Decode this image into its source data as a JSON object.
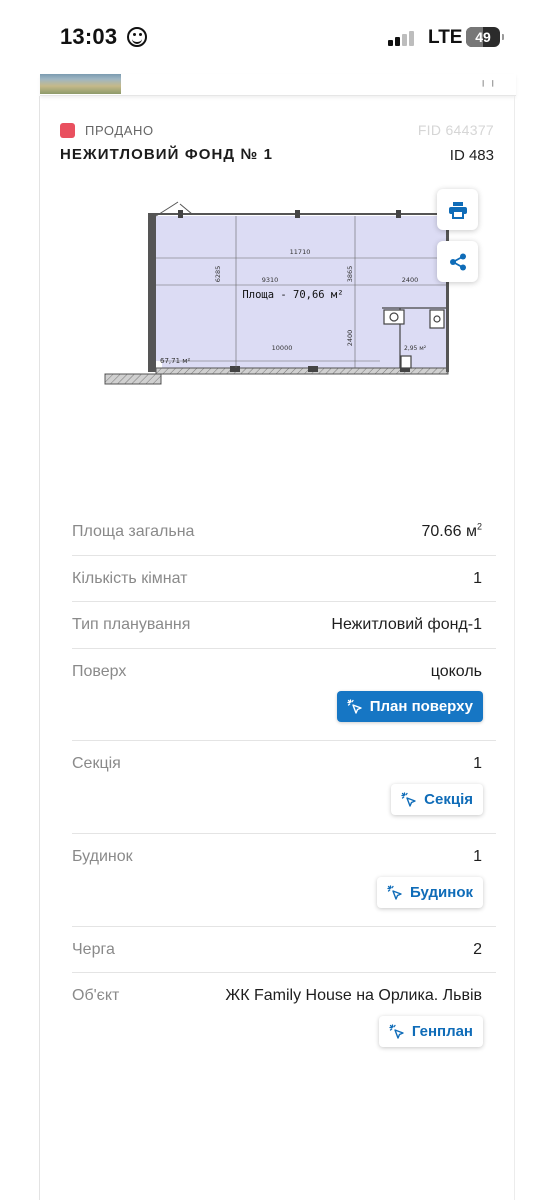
{
  "status_bar": {
    "time": "13:03",
    "network": "LTE",
    "battery": "49",
    "battery_level": 0.49
  },
  "listing": {
    "status": "ПРОДАНО",
    "status_color": "#e9505f",
    "fid": "FID 644377",
    "title": "НЕЖИТЛОВИЙ ФОНД № 1",
    "id": "ID 483"
  },
  "floor_plan": {
    "dims": {
      "d1": "11710",
      "d2": "9310",
      "d3": "6285",
      "d4": "3865",
      "d5": "2400",
      "d6": "10000",
      "d7": "2400"
    },
    "area_label": "Площа - 70,66 м²",
    "room_area": "67,71 м²",
    "wc_area": "2,95 м²"
  },
  "actions": {
    "print_icon": "printer-icon",
    "share_icon": "share-icon"
  },
  "details": {
    "area": {
      "label": "Площа загальна",
      "value": "70.66 м",
      "unit_sup": "2"
    },
    "rooms": {
      "label": "Кількість кімнат",
      "value": "1"
    },
    "layout_type": {
      "label": "Тип планування",
      "value": "Нежитловий фонд-1"
    },
    "floor": {
      "label": "Поверх",
      "value": "цоколь",
      "button": "План поверху"
    },
    "section": {
      "label": "Секція",
      "value": "1",
      "button": "Секція"
    },
    "building": {
      "label": "Будинок",
      "value": "1",
      "button": "Будинок"
    },
    "queue": {
      "label": "Черга",
      "value": "2"
    },
    "object": {
      "label": "Об'єкт",
      "value": "ЖК Family House на Орлика. Львів",
      "button": "Генплан"
    }
  },
  "colors": {
    "primary_button": "#1676c4",
    "link_blue": "#0f6cb8",
    "plan_fill": "#dcdcf4"
  }
}
